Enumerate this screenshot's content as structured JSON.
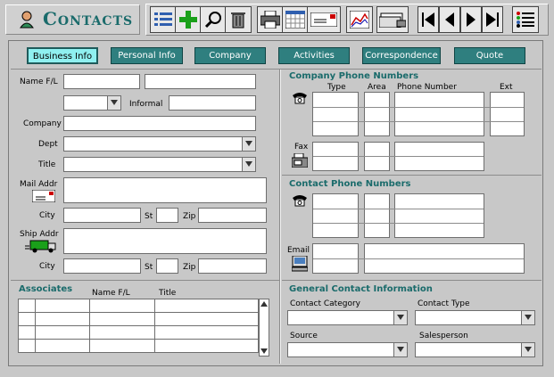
{
  "window": {
    "title": "Contacts"
  },
  "toolbar": {
    "groups": [
      "list-icon",
      "add-icon",
      "find-icon",
      "trash-icon",
      "printer-icon",
      "calendar-icon",
      "letter-icon",
      "chart-icon",
      "cards-icon",
      "first-icon",
      "prev-icon",
      "next-icon",
      "last-icon",
      "menu-icon"
    ]
  },
  "tabs": [
    "Business Info",
    "Personal Info",
    "Company",
    "Activities",
    "Correspondence",
    "Quote"
  ],
  "form": {
    "name_label": "Name F/L",
    "informal_label": "Informal",
    "company_label": "Company",
    "dept_label": "Dept",
    "title_label": "Title",
    "mail_label": "Mail Addr",
    "city_label": "City",
    "st_label": "St",
    "zip_label": "Zip",
    "ship_label": "Ship Addr",
    "city2_label": "City",
    "st2_label": "St",
    "zip2_label": "Zip"
  },
  "company_phone": {
    "heading": "Company Phone Numbers",
    "col_type": "Type",
    "col_area": "Area",
    "col_number": "Phone Number",
    "col_ext": "Ext",
    "fax_label": "Fax"
  },
  "contact_phone": {
    "heading": "Contact Phone Numbers",
    "email_label": "Email"
  },
  "associates": {
    "heading": "Associates",
    "col_name": "Name F/L",
    "col_title": "Title"
  },
  "general": {
    "heading": "General Contact Information",
    "category_label": "Contact Category",
    "type_label": "Contact Type",
    "source_label": "Source",
    "salesperson_label": "Salesperson"
  },
  "colors": {
    "accent": "#2f7f7f",
    "active_tab": "#8ff0f0",
    "heading": "#1a6b6b"
  }
}
